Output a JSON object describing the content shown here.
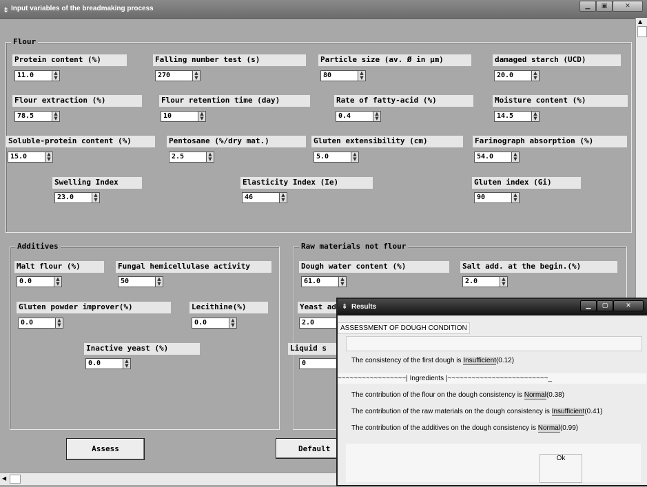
{
  "window": {
    "title": "Input variables of the breadmaking process"
  },
  "flour": {
    "title": "Flour",
    "fields": [
      {
        "label": "Protein content (%)",
        "value": "11.0"
      },
      {
        "label": "Falling number test (s)",
        "value": "270"
      },
      {
        "label": "Particle size (av. Ø in µm)",
        "value": "80"
      },
      {
        "label": "damaged starch (UCD)",
        "value": "20.0"
      },
      {
        "label": "Flour extraction (%)",
        "value": "78.5"
      },
      {
        "label": "Flour retention time (day)",
        "value": "10"
      },
      {
        "label": "Rate of fatty-acid (%)",
        "value": "0.4"
      },
      {
        "label": "Moisture content (%)",
        "value": "14.5"
      },
      {
        "label": "Soluble-protein content (%)",
        "value": "15.0"
      },
      {
        "label": "Pentosane (%/dry mat.)",
        "value": "2.5"
      },
      {
        "label": "Gluten extensibility (cm)",
        "value": "5.0"
      },
      {
        "label": "Farinograph absorption (%)",
        "value": "54.0"
      },
      {
        "label": "Swelling Index",
        "value": "23.0"
      },
      {
        "label": "Elasticity Index (Ie)",
        "value": "46"
      },
      {
        "label": "Gluten index (Gi)",
        "value": "90"
      }
    ]
  },
  "additives": {
    "title": "Additives",
    "fields": [
      {
        "label": "Malt flour (%)",
        "value": "0.0"
      },
      {
        "label": "Fungal hemicellulase activity",
        "value": "50"
      },
      {
        "label": "Gluten powder improver(%)",
        "value": "0.0"
      },
      {
        "label": "Lecithine(%)",
        "value": "0.0"
      },
      {
        "label": "Inactive yeast (%)",
        "value": "0.0"
      }
    ]
  },
  "raw": {
    "title": "Raw materials not flour",
    "fields": [
      {
        "label": "Dough water content (%)",
        "value": "61.0"
      },
      {
        "label": "Salt add. at the begin.(%)",
        "value": "2.0"
      },
      {
        "label": "Yeast ad",
        "value": "2.0"
      },
      {
        "label": "Liquid s",
        "value": "0"
      }
    ]
  },
  "buttons": {
    "assess": "Assess",
    "default": "Default"
  },
  "results": {
    "title": "Results",
    "heading": "ASSESSMENT OF DOUGH CONDITION",
    "line1": {
      "prefix": "The consistency of the first dough is",
      "value": "Insufficient",
      "score": "(0.12)"
    },
    "separator_left": "~~~~~~~~~~~~~~~~~| Ingredients |",
    "separator_right": "~~~~~~~~~~~~~~~~~~~~~~~~~_",
    "line2": {
      "prefix": "The contribution of the flour on the dough consistency is",
      "value": "Normal",
      "score": "(0.38)"
    },
    "line3": {
      "prefix": "The contribution of the raw materials on the dough consistency is",
      "value": "Insufficient",
      "score": "(0.41)"
    },
    "line4": {
      "prefix": "The contribution of the additives on the dough consistency is",
      "value": "Normal",
      "score": "(0.99)"
    },
    "ok": "Ok"
  }
}
